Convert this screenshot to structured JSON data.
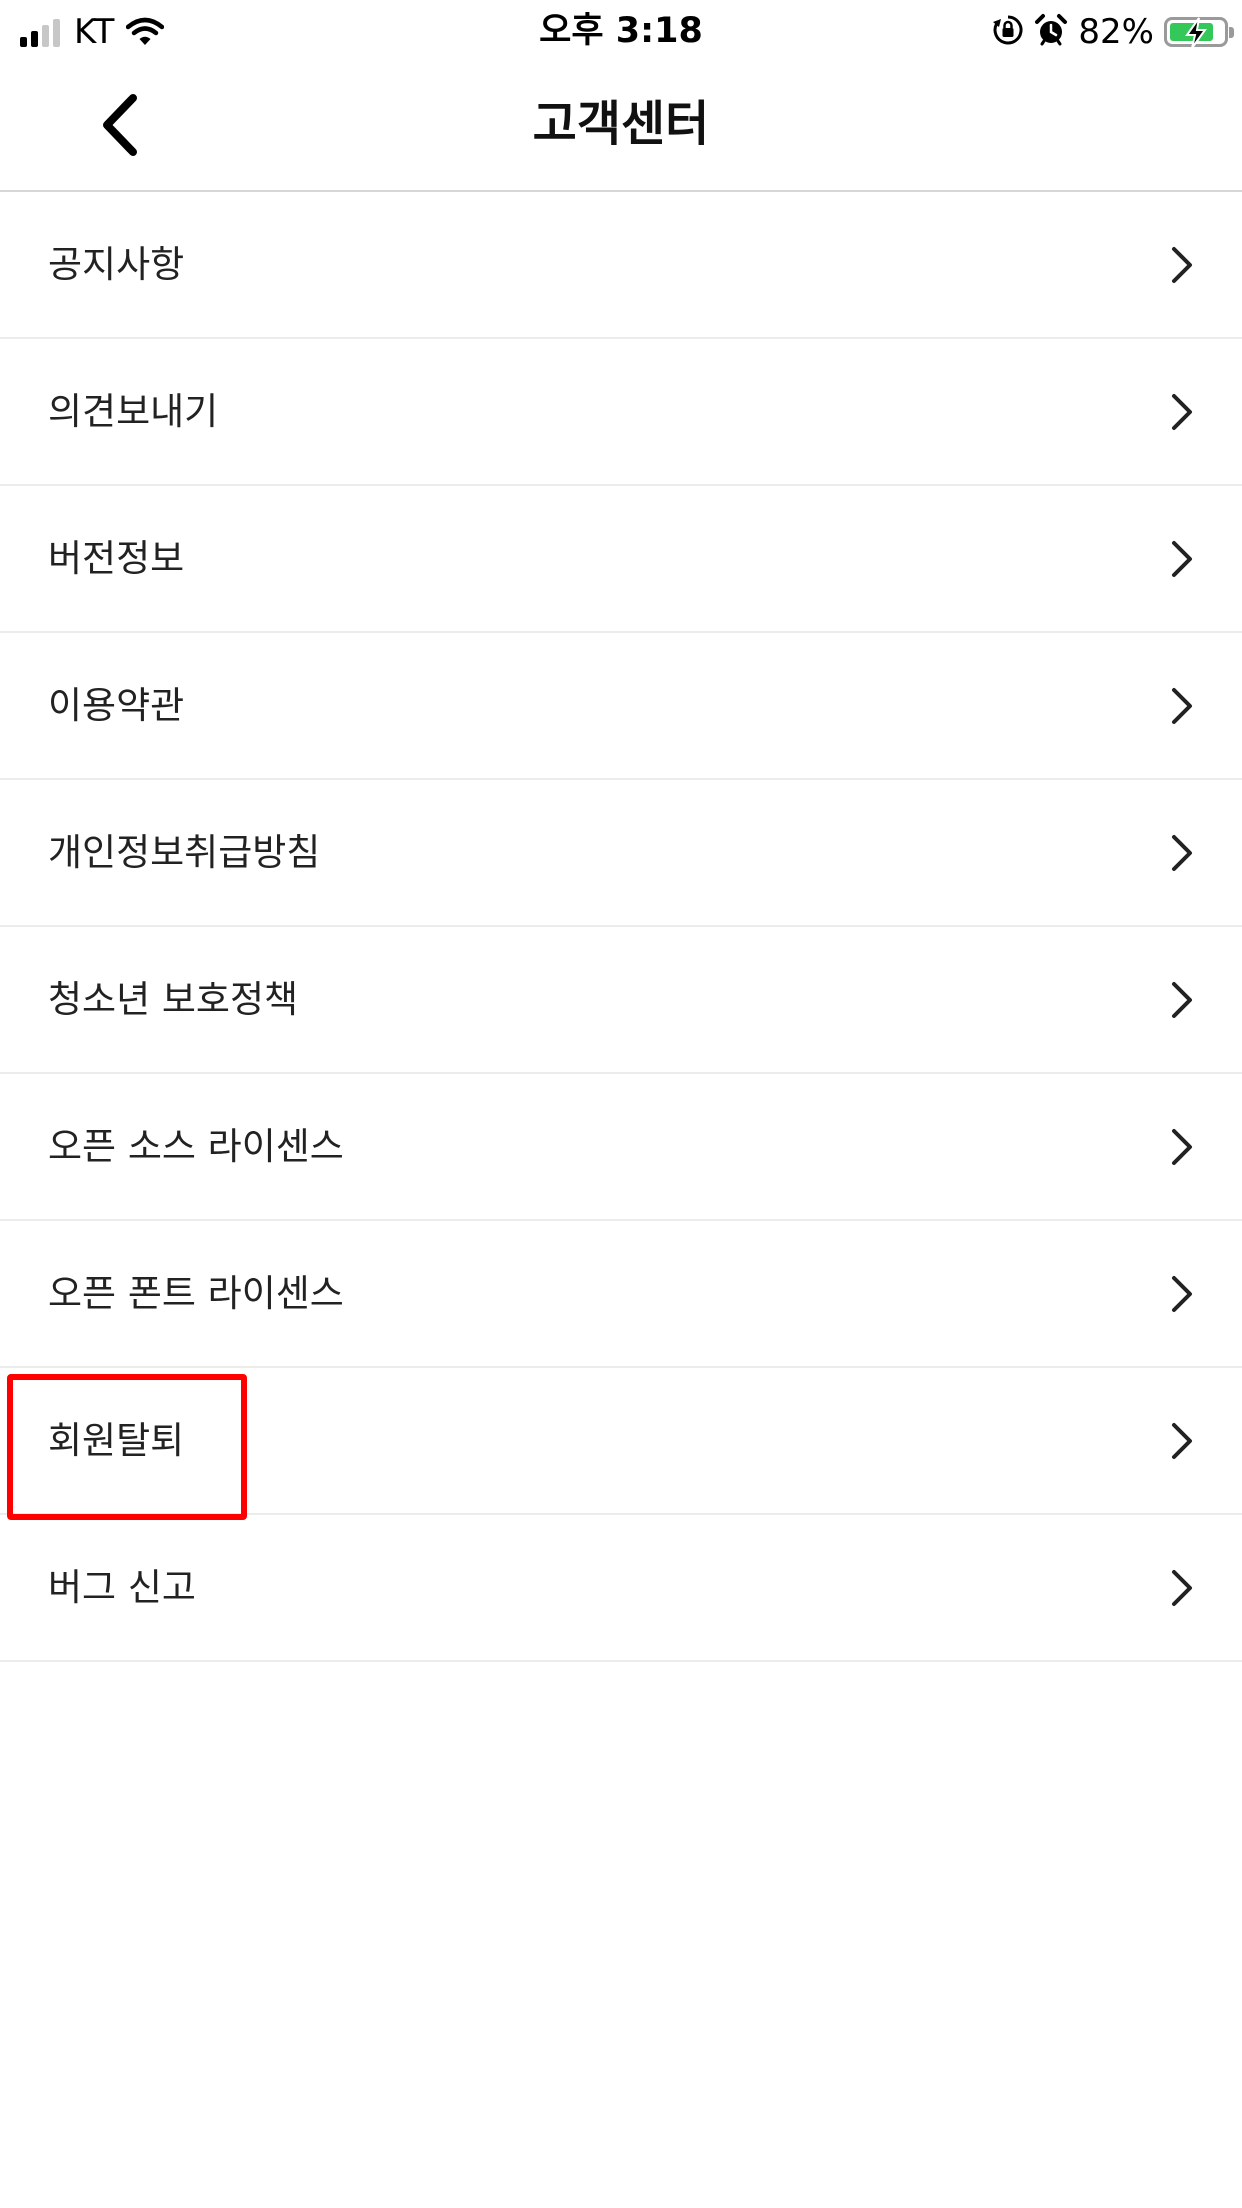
{
  "status_bar": {
    "carrier": "KT",
    "time": "오후 3:18",
    "battery_percent": "82%",
    "battery_level": 0.82,
    "icons": [
      "signal-icon",
      "wifi-icon",
      "rotation-lock-icon",
      "alarm-icon",
      "battery-icon"
    ]
  },
  "nav": {
    "title": "고객센터",
    "back_icon": "chevron-left-icon"
  },
  "menu": {
    "items": [
      {
        "label": "공지사항"
      },
      {
        "label": "의견보내기"
      },
      {
        "label": "버전정보"
      },
      {
        "label": "이용약관"
      },
      {
        "label": "개인정보취급방침"
      },
      {
        "label": "청소년 보호정책"
      },
      {
        "label": "오픈 소스 라이센스"
      },
      {
        "label": "오픈 폰트 라이센스"
      },
      {
        "label": "회원탈퇴"
      },
      {
        "label": "버그 신고"
      }
    ],
    "item_icon": "chevron-right-icon"
  },
  "colors": {
    "highlight": "#ff0000",
    "battery_fill": "#34c759",
    "divider": "#ececec"
  }
}
